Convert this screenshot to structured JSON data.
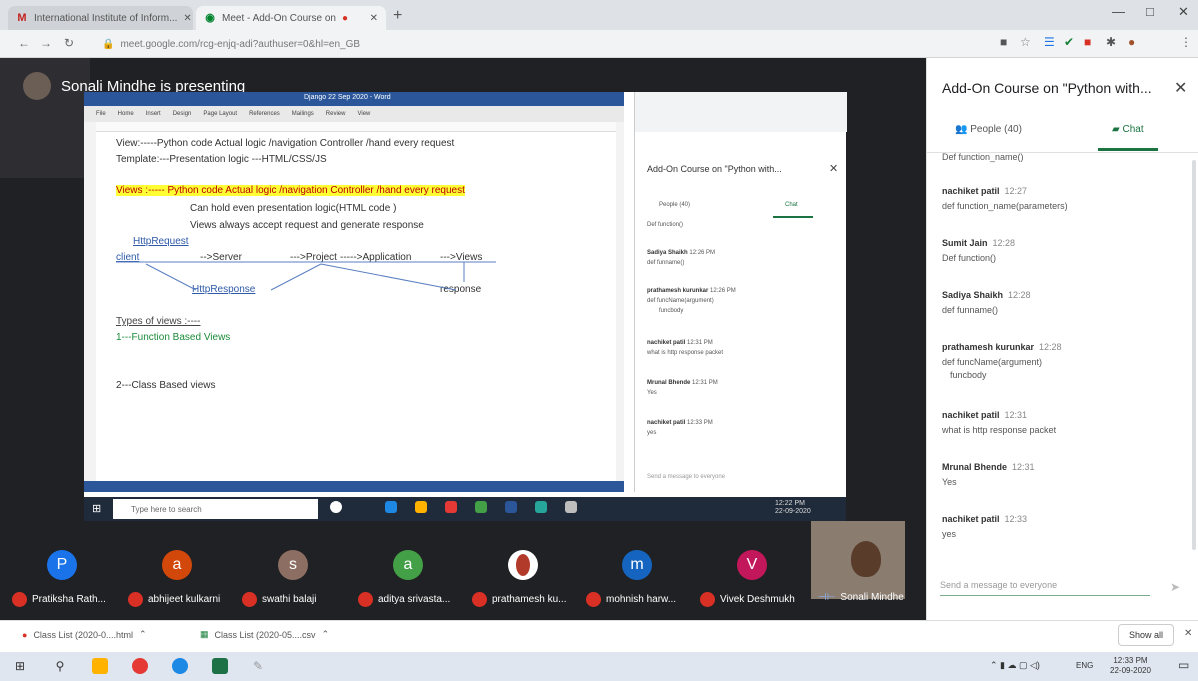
{
  "browser": {
    "tabs": [
      {
        "label": "International Institute of Inform...",
        "active": false
      },
      {
        "label": "Meet - Add-On Course on",
        "active": true
      }
    ],
    "url": "meet.google.com/rcg-enjq-adi?authuser=0&hl=en_GB"
  },
  "presenter": {
    "label": "Sonali Mindhe is presenting"
  },
  "word": {
    "title": "Django 22 Sep 2020 - Word",
    "ribbon_tabs": [
      "File",
      "Home",
      "Insert",
      "Design",
      "Page Layout",
      "References",
      "Mailings",
      "Review",
      "View"
    ],
    "lines": {
      "l1": "View:-----Python code Actual logic /navigation Controller /hand every request",
      "l2": "Template:---Presentation logic ---HTML/CSS/JS",
      "l3": "Views :----- Python code Actual logic /navigation Controller /hand every request",
      "l4": "Can hold even presentation logic(HTML code )",
      "l5": "Views always accept request and generate response",
      "l6": "HttpRequest",
      "d_client": "client",
      "d_server": "-->Server",
      "d_project": "--->Project",
      "d_application": "----->Application",
      "d_views": "--->Views",
      "d_httpresponse": "HttpResponse",
      "d_response": "response",
      "l7": "Types of views :----",
      "l8": "1---Function Based Views",
      "l9": "2---Class Based views"
    },
    "search_placeholder": "Type here to search",
    "clock_time": "12:22 PM",
    "clock_date": "22-09-2020"
  },
  "inner_chat": {
    "title": "Add-On Course on \"Python with...",
    "people": "People (40)",
    "chat": "Chat",
    "m0": "Def function()",
    "m1_name": "Sadiya Shaikh",
    "m1_time": "12:26 PM",
    "m1_text": "def funname()",
    "m2_name": "prathamesh kurunkar",
    "m2_time": "12:26 PM",
    "m2_text": "def funcName(argument)",
    "m2_text2": "funcbody",
    "m3_name": "nachiket patil",
    "m3_time": "12:31 PM",
    "m3_text": "what is http response packet",
    "m4_name": "Mrunal Bhende",
    "m4_time": "12:31 PM",
    "m4_text": "Yes",
    "m5_name": "nachiket patil",
    "m5_time": "12:33 PM",
    "m5_text": "yes",
    "input": "Send a message to everyone"
  },
  "participants": [
    {
      "initial": "P",
      "name": "Pratiksha Rath...",
      "color": "#1a73e8"
    },
    {
      "initial": "a",
      "name": "abhijeet kulkarni",
      "color": "#d2480b"
    },
    {
      "initial": "s",
      "name": "swathi balaji",
      "color": "#8d6e63"
    },
    {
      "initial": "a",
      "name": "aditya srivasta...",
      "color": "#43a047"
    },
    {
      "initial": "",
      "name": "prathamesh ku...",
      "color": "#ffffff"
    },
    {
      "initial": "m",
      "name": "mohnish harw...",
      "color": "#1565c0"
    },
    {
      "initial": "V",
      "name": "Vivek Deshmukh",
      "color": "#c2185b"
    }
  ],
  "self_view": {
    "name": "Sonali Mindhe"
  },
  "chat": {
    "title": "Add-On Course on \"Python with...",
    "people_tab": "People (40)",
    "chat_tab": "Chat",
    "m0": "Def function_name()",
    "messages": [
      {
        "name": "nachiket patil",
        "time": "12:27",
        "text": "def function_name(parameters)"
      },
      {
        "name": "Sumit Jain",
        "time": "12:28",
        "text": "Def function()"
      },
      {
        "name": "Sadiya Shaikh",
        "time": "12:28",
        "text": "def funname()"
      },
      {
        "name": "prathamesh kurunkar",
        "time": "12:28",
        "text": "def funcName(argument)",
        "text2": "funcbody"
      },
      {
        "name": "nachiket patil",
        "time": "12:31",
        "text": "what is http response packet"
      },
      {
        "name": "Mrunal Bhende",
        "time": "12:31",
        "text": "Yes"
      },
      {
        "name": "nachiket patil",
        "time": "12:33",
        "text": "yes"
      }
    ],
    "input_placeholder": "Send a message to everyone"
  },
  "downloads": [
    {
      "name": "Class List (2020-0....html"
    },
    {
      "name": "Class List (2020-05....csv"
    }
  ],
  "show_all": "Show all",
  "taskbar": {
    "time": "12:33 PM",
    "date": "22-09-2020",
    "lang": "ENG"
  },
  "colors": {
    "chat_accent": "#1a7340",
    "word_blue": "#2b579a",
    "highlight": "#ffff33"
  }
}
